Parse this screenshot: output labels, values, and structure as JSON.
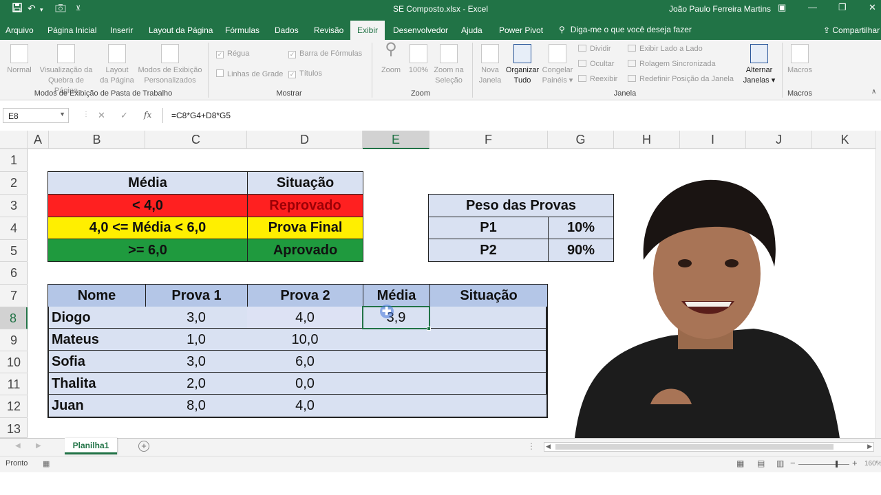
{
  "window": {
    "title": "SE Composto.xlsx  -  Excel",
    "user": "João Paulo Ferreira Martins"
  },
  "tabs": [
    "Arquivo",
    "Página Inicial",
    "Inserir",
    "Layout da Página",
    "Fórmulas",
    "Dados",
    "Revisão",
    "Exibir",
    "Desenvolvedor",
    "Ajuda",
    "Power Pivot"
  ],
  "active_tab": "Exibir",
  "tell_me": "Diga-me o que você deseja fazer",
  "share": "Compartilhar",
  "ribbon": {
    "modos": {
      "normal": "Normal",
      "quebra": [
        "Visualização da",
        "Quebra de Página"
      ],
      "layout": [
        "Layout",
        "da Página"
      ],
      "personalizados": [
        "Modos de Exibição",
        "Personalizados"
      ],
      "group": "Modos de Exibição de Pasta de Trabalho"
    },
    "mostrar": {
      "regua": "Régua",
      "barra": "Barra de Fórmulas",
      "linhas": "Linhas de Grade",
      "titulos": "Títulos",
      "group": "Mostrar"
    },
    "zoom": {
      "zoom": "Zoom",
      "cem": "100%",
      "selecao": [
        "Zoom na",
        "Seleção"
      ],
      "group": "Zoom"
    },
    "janela": {
      "nova": [
        "Nova",
        "Janela"
      ],
      "organizar": [
        "Organizar",
        "Tudo"
      ],
      "congelar": [
        "Congelar",
        "Painéis ▾"
      ],
      "dividir": "Dividir",
      "ocultar": "Ocultar",
      "reexibir": "Reexibir",
      "lado": "Exibir Lado a Lado",
      "rolagem": "Rolagem Sincronizada",
      "redefinir": "Redefinir Posição da Janela",
      "alternar": [
        "Alternar",
        "Janelas ▾"
      ],
      "group": "Janela"
    },
    "macros": {
      "macros": "Macros",
      "group": "Macros"
    }
  },
  "formula_bar": {
    "name_box": "E8",
    "formula": "=C8*G4+D8*G5"
  },
  "columns": [
    "A",
    "B",
    "C",
    "D",
    "E",
    "F",
    "G",
    "H",
    "I",
    "J",
    "K"
  ],
  "rows": [
    "1",
    "2",
    "3",
    "4",
    "5",
    "6",
    "7",
    "8",
    "9",
    "10",
    "11",
    "12",
    "13"
  ],
  "legend_table": {
    "headers": [
      "Média",
      "Situação"
    ],
    "rows": [
      {
        "range": "< 4,0",
        "status": "Reprovado",
        "color": "#ff2020"
      },
      {
        "range": "4,0 <= Média < 6,0",
        "status": "Prova Final",
        "color": "#ffef00"
      },
      {
        "range": ">= 6,0",
        "status": "Aprovado",
        "color": "#1f9a3e"
      }
    ]
  },
  "weights_table": {
    "title": "Peso das Provas",
    "rows": [
      {
        "label": "P1",
        "value": "10%"
      },
      {
        "label": "P2",
        "value": "90%"
      }
    ]
  },
  "grades_table": {
    "headers": [
      "Nome",
      "Prova 1",
      "Prova 2",
      "Média",
      "Situação"
    ],
    "rows": [
      {
        "nome": "Diogo",
        "p1": "3,0",
        "p2": "4,0",
        "media": "3,9",
        "situacao": ""
      },
      {
        "nome": "Mateus",
        "p1": "1,0",
        "p2": "10,0",
        "media": "",
        "situacao": ""
      },
      {
        "nome": "Sofia",
        "p1": "3,0",
        "p2": "6,0",
        "media": "",
        "situacao": ""
      },
      {
        "nome": "Thalita",
        "p1": "2,0",
        "p2": "0,0",
        "media": "",
        "situacao": ""
      },
      {
        "nome": "Juan",
        "p1": "8,0",
        "p2": "4,0",
        "media": "",
        "situacao": ""
      }
    ]
  },
  "sheet_tab": "Planilha1",
  "status": {
    "ready": "Pronto",
    "zoom": "160%"
  },
  "colors": {
    "excel_green": "#217346",
    "table_fill": "#d9e1f2"
  }
}
